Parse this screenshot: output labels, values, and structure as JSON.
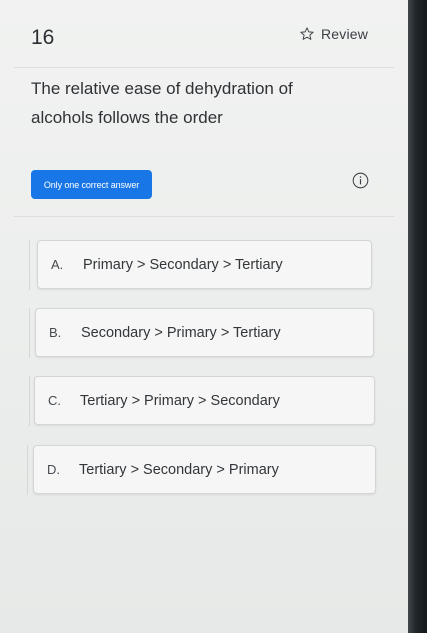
{
  "header": {
    "question_number": "16",
    "review_label": "Review",
    "review_icon": "star-outline-icon"
  },
  "question": {
    "text": "The relative ease of dehydration of alcohols follows the order"
  },
  "answer_type": {
    "label": "Only one correct answer",
    "color": "#1976e6",
    "info_icon": "info-icon"
  },
  "options": [
    {
      "letter": "A.",
      "text": "Primary > Secondary > Tertiary"
    },
    {
      "letter": "B.",
      "text": "Secondary > Primary > Tertiary"
    },
    {
      "letter": "C.",
      "text": "Tertiary > Primary > Secondary"
    },
    {
      "letter": "D.",
      "text": "Tertiary > Secondary > Primary"
    }
  ]
}
